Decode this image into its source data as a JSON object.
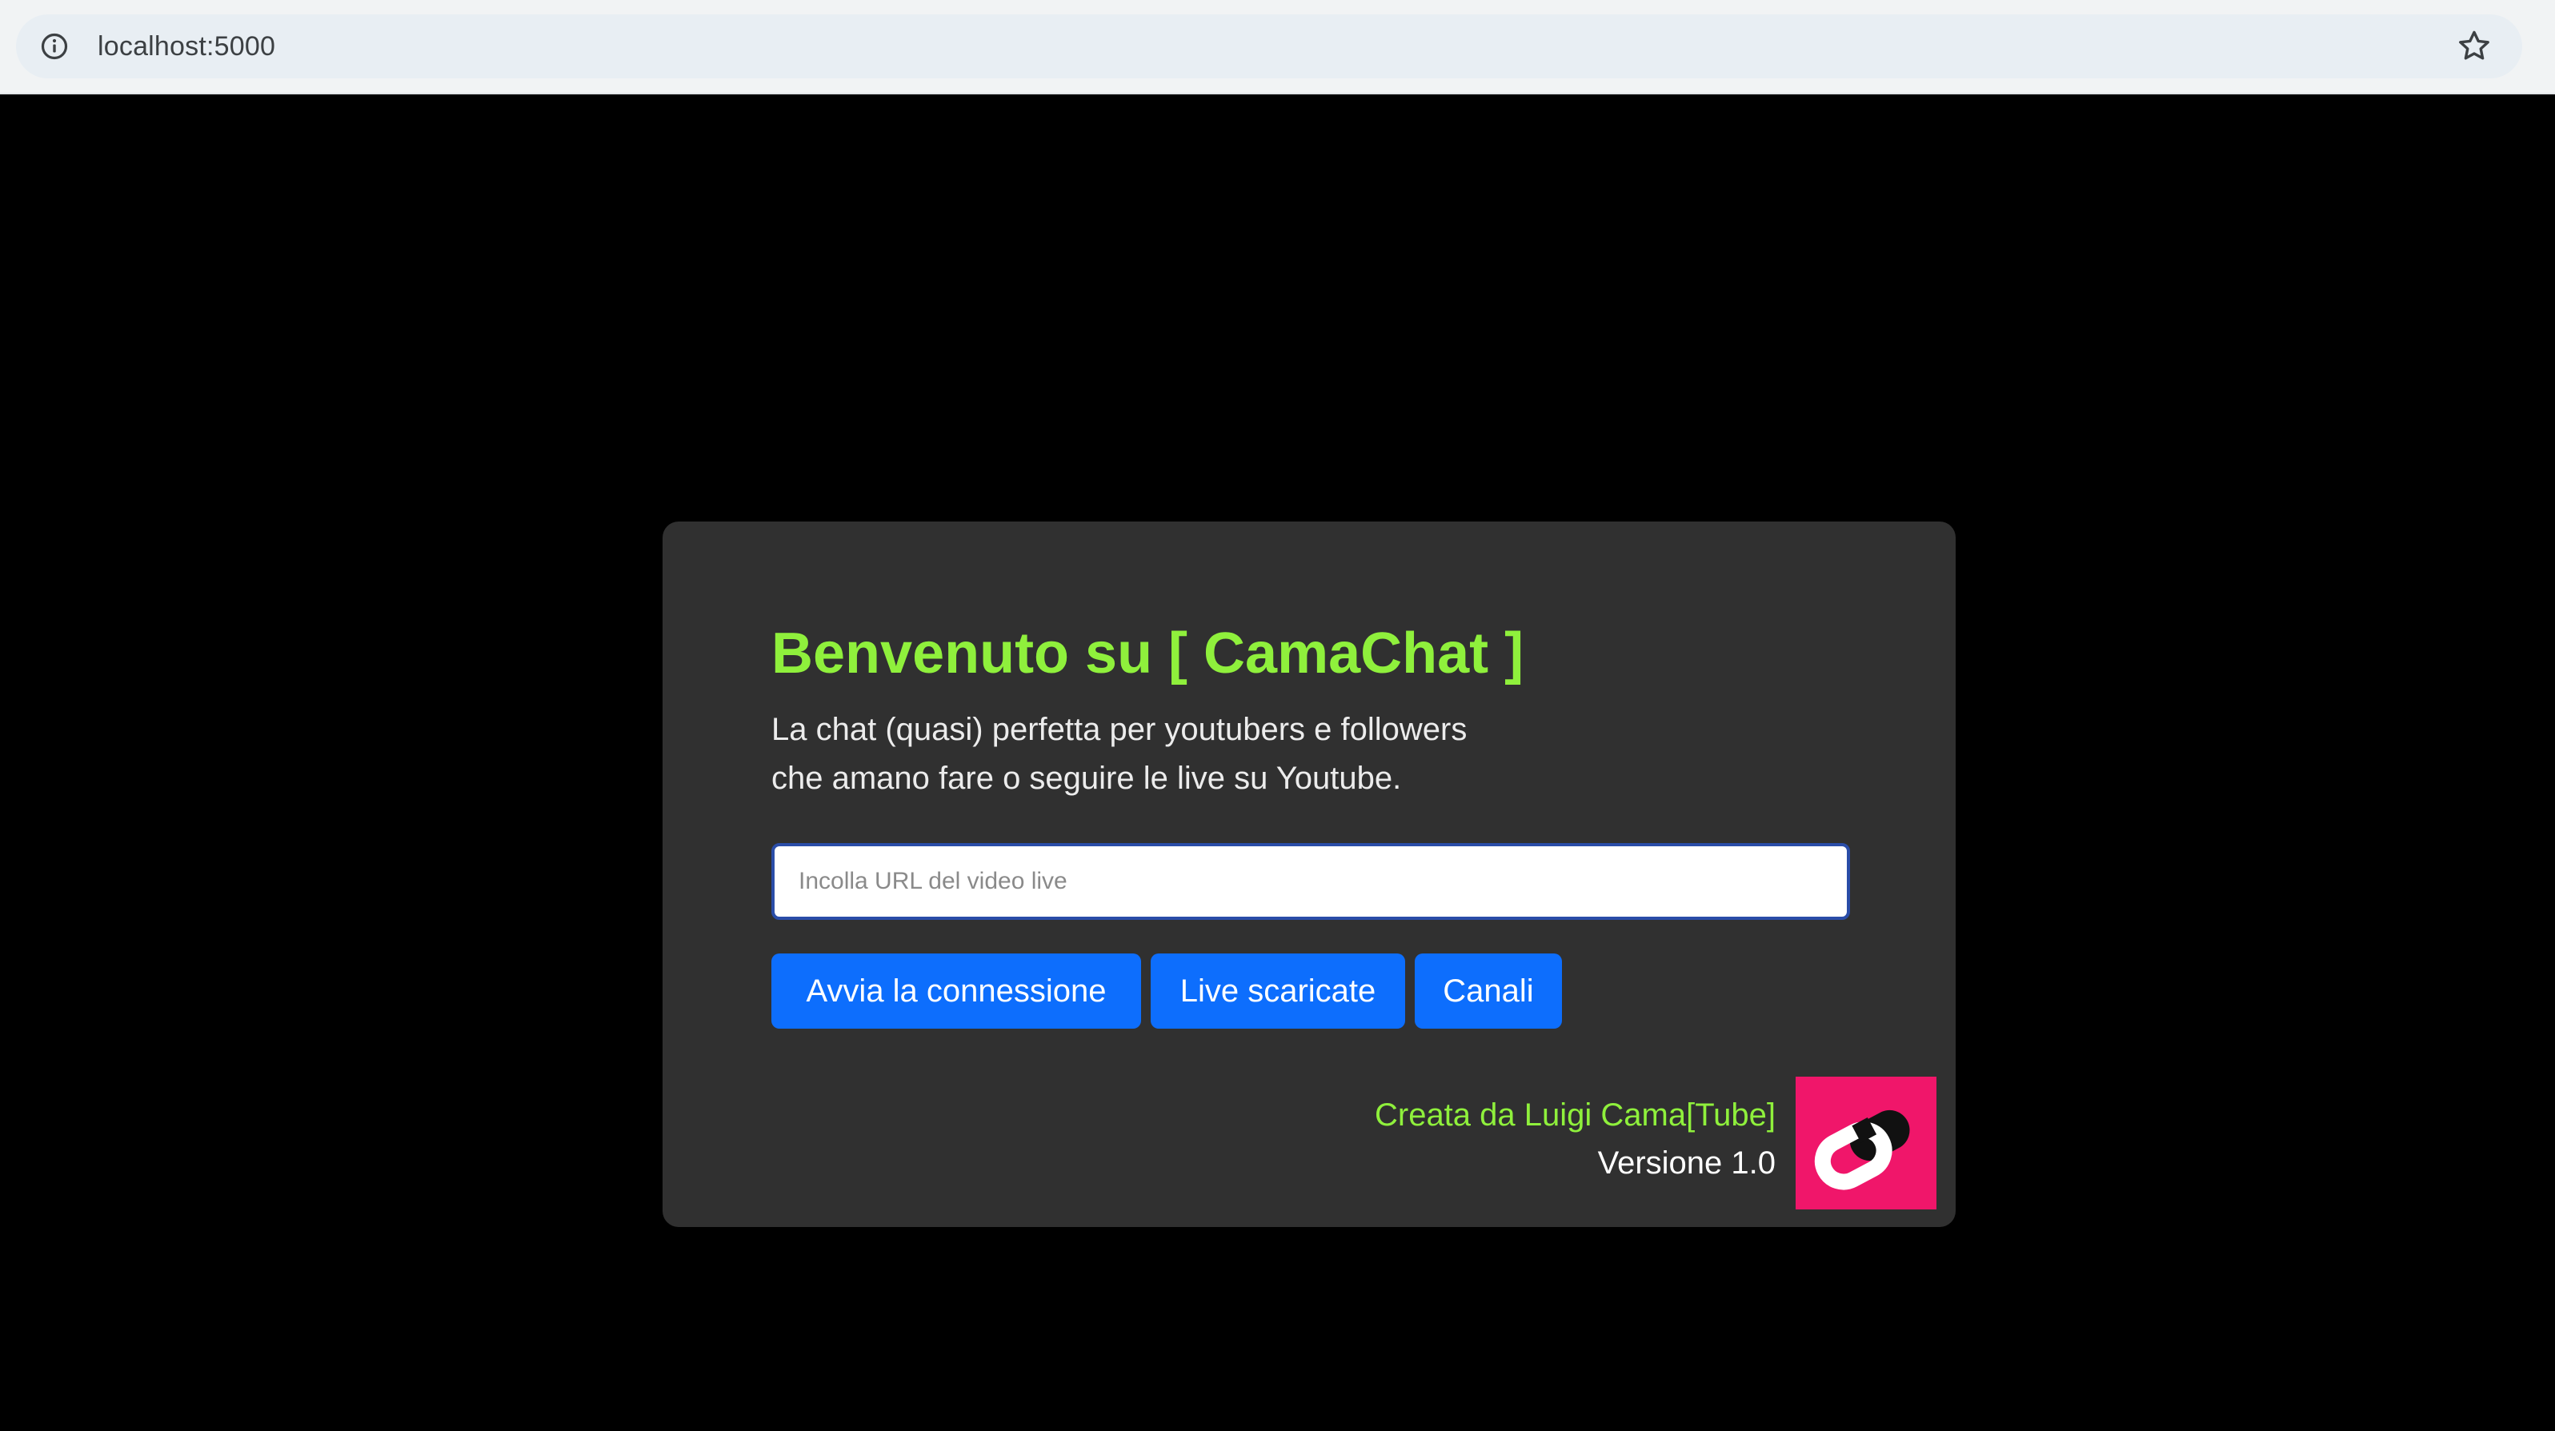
{
  "browser": {
    "url": "localhost:5000",
    "site_info_icon": "info-circle-icon",
    "bookmark_icon": "star-outline-icon"
  },
  "card": {
    "title": "Benvenuto su [ CamaChat ]",
    "subtitle_line1": "La chat (quasi) perfetta per youtubers e followers",
    "subtitle_line2": "che amano fare o seguire le live su Youtube.",
    "input": {
      "placeholder": "Incolla URL del video live",
      "value": ""
    },
    "buttons": {
      "connect_label": "Avvia la connessione",
      "downloaded_label": "Live scaricate",
      "channels_label": "Canali"
    },
    "credits": {
      "author": "Creata da Luigi Cama[Tube]",
      "version": "Versione 1.0"
    },
    "logo_icon": "camatube-logo"
  },
  "colors": {
    "page_background": "#000000",
    "card_background": "#303030",
    "title_green": "#8ff03c",
    "button_blue": "#0d6efd",
    "logo_pink": "#f0166a"
  }
}
